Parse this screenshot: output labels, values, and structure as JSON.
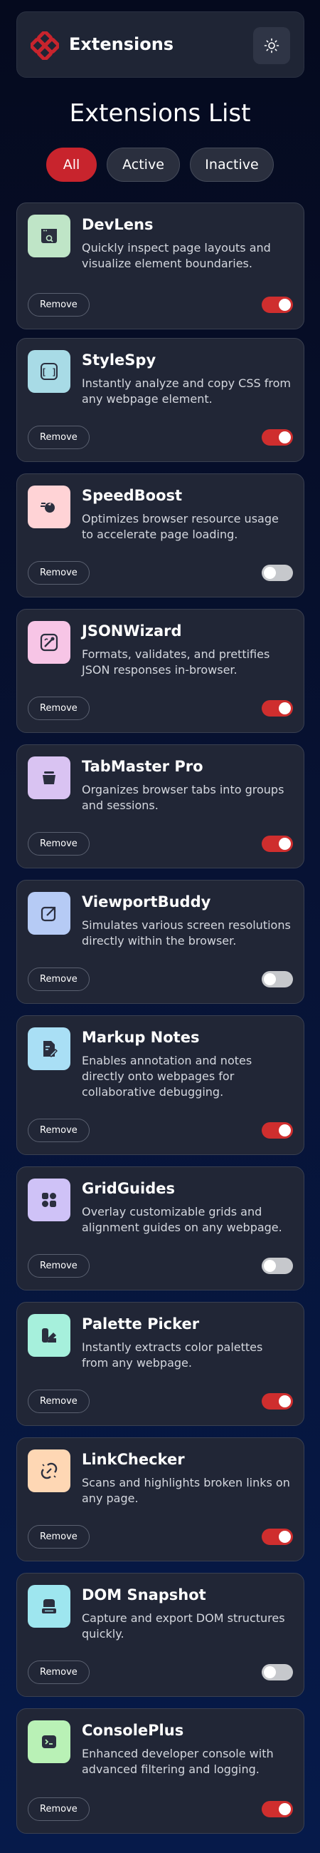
{
  "header": {
    "logo_text": "Extensions",
    "logo_color": "#c8242d",
    "theme_icon": "sun-icon"
  },
  "page_title": "Extensions List",
  "filters": [
    {
      "label": "All",
      "active": true
    },
    {
      "label": "Active",
      "active": false
    },
    {
      "label": "Inactive",
      "active": false
    }
  ],
  "extensions": [
    {
      "name": "DevLens",
      "description": "Quickly inspect page layouts and visualize element boundaries.",
      "remove_label": "Remove",
      "enabled": true,
      "icon": "devlens-icon",
      "icon_bg": "#bfe5c7"
    },
    {
      "name": "StyleSpy",
      "description": "Instantly analyze and copy CSS from any webpage element.",
      "remove_label": "Remove",
      "enabled": true,
      "icon": "stylespy-icon",
      "icon_bg": "#a8dbe6"
    },
    {
      "name": "SpeedBoost",
      "description": "Optimizes browser resource usage to accelerate page loading.",
      "remove_label": "Remove",
      "enabled": false,
      "icon": "speedboost-icon",
      "icon_bg": "#ffd3d6"
    },
    {
      "name": "JSONWizard",
      "description": "Formats, validates, and prettifies JSON responses in-browser.",
      "remove_label": "Remove",
      "enabled": true,
      "icon": "jsonwizard-icon",
      "icon_bg": "#f7c5e6"
    },
    {
      "name": "TabMaster Pro",
      "description": "Organizes browser tabs into groups and sessions.",
      "remove_label": "Remove",
      "enabled": true,
      "icon": "tabmaster-icon",
      "icon_bg": "#d9c3f2"
    },
    {
      "name": "ViewportBuddy",
      "description": "Simulates various screen resolutions directly within the browser.",
      "remove_label": "Remove",
      "enabled": false,
      "icon": "viewportbuddy-icon",
      "icon_bg": "#b6cbf5"
    },
    {
      "name": "Markup Notes",
      "description": "Enables annotation and notes directly onto webpages for collaborative debugging.",
      "remove_label": "Remove",
      "enabled": true,
      "icon": "markupnotes-icon",
      "icon_bg": "#a9dff5"
    },
    {
      "name": "GridGuides",
      "description": "Overlay customizable grids and alignment guides on any webpage.",
      "remove_label": "Remove",
      "enabled": false,
      "icon": "gridguides-icon",
      "icon_bg": "#cfc2f7"
    },
    {
      "name": "Palette Picker",
      "description": "Instantly extracts color palettes from any webpage.",
      "remove_label": "Remove",
      "enabled": true,
      "icon": "palettepicker-icon",
      "icon_bg": "#a6f0dc"
    },
    {
      "name": "LinkChecker",
      "description": "Scans and highlights broken links on any page.",
      "remove_label": "Remove",
      "enabled": true,
      "icon": "linkchecker-icon",
      "icon_bg": "#fed7b4"
    },
    {
      "name": "DOM Snapshot",
      "description": "Capture and export DOM structures quickly.",
      "remove_label": "Remove",
      "enabled": false,
      "icon": "domsnapshot-icon",
      "icon_bg": "#9ee6ef"
    },
    {
      "name": "ConsolePlus",
      "description": "Enhanced developer console with advanced filtering and logging.",
      "remove_label": "Remove",
      "enabled": true,
      "icon": "consoleplus-icon",
      "icon_bg": "#b9f1b6"
    }
  ]
}
